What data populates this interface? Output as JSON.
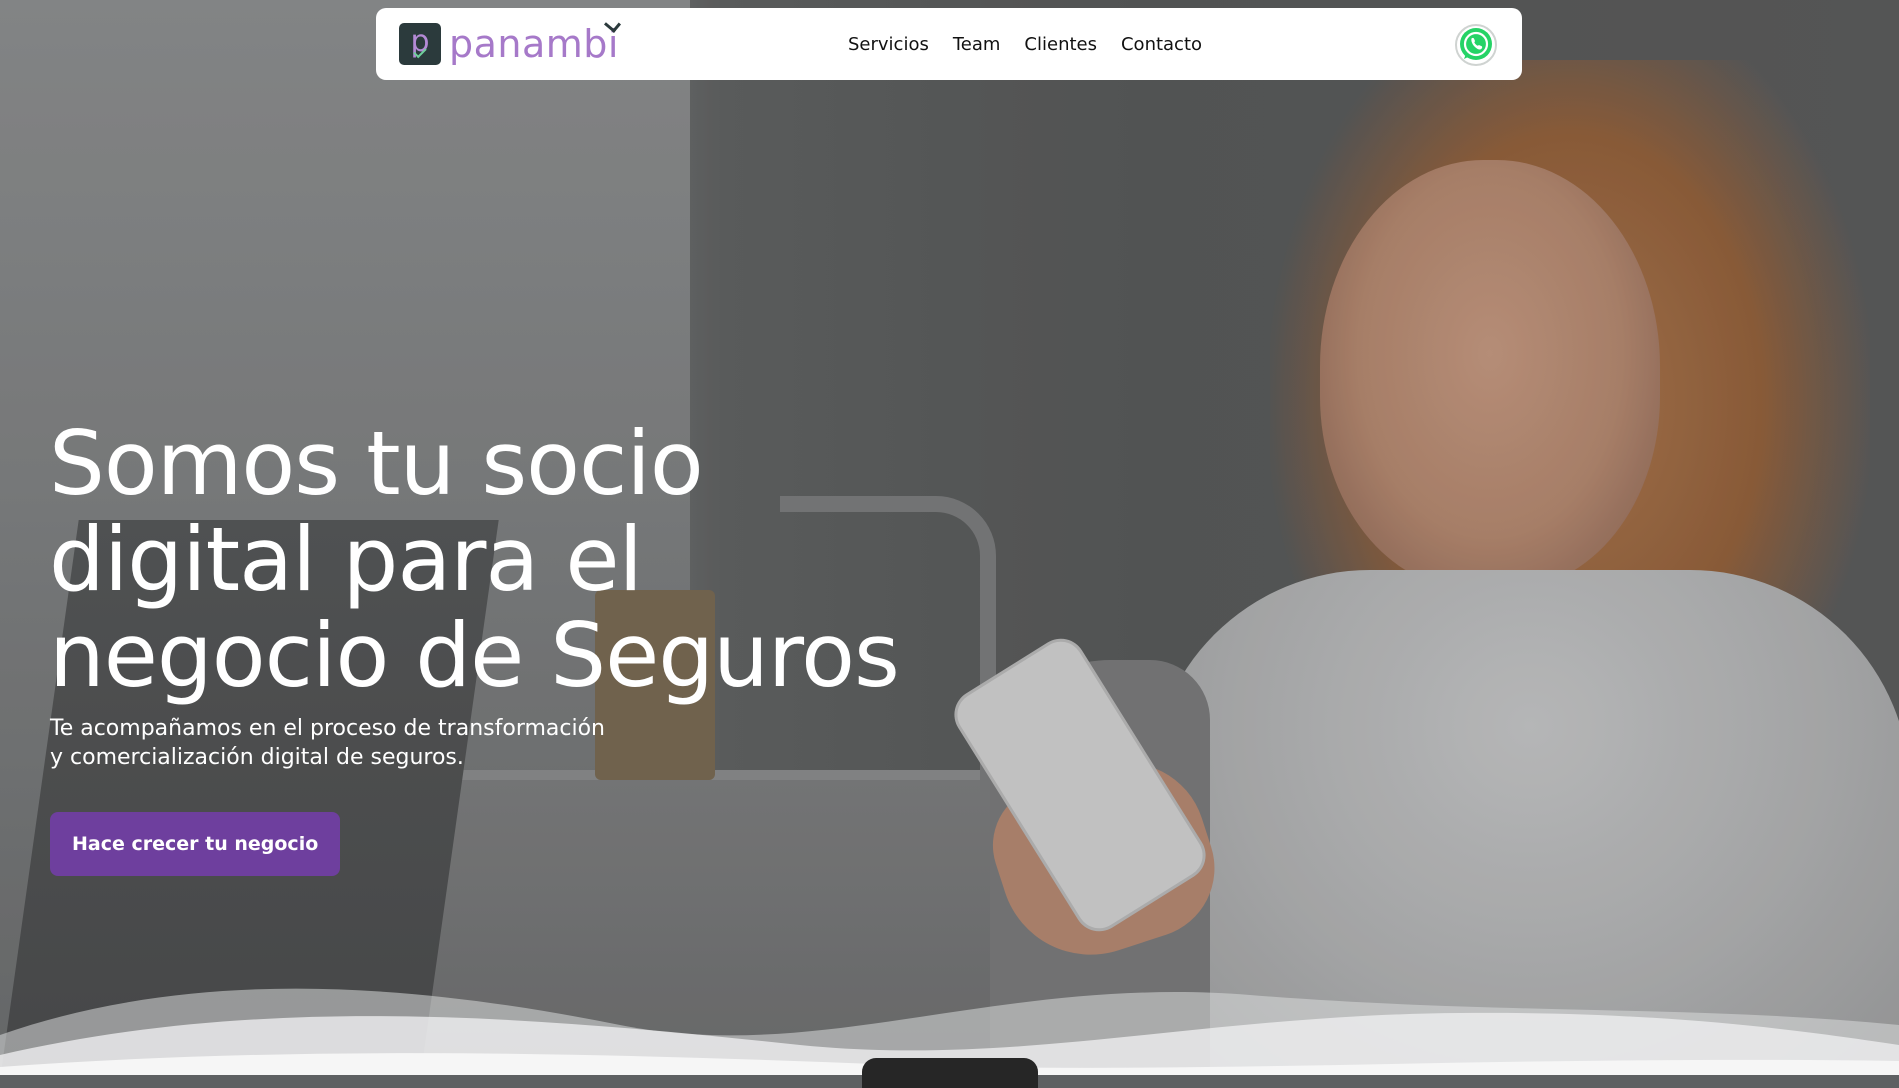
{
  "brand": {
    "name": "panambi",
    "mark_letter": "p",
    "primary_color": "#6e3f9e",
    "logo_text_color": "#a679c9",
    "mark_bg_color": "#2b3a3c"
  },
  "nav": {
    "items": [
      {
        "label": "Servicios"
      },
      {
        "label": "Team"
      },
      {
        "label": "Clientes"
      },
      {
        "label": "Contacto"
      }
    ],
    "whatsapp_icon": "whatsapp-icon",
    "whatsapp_color": "#25d366"
  },
  "hero": {
    "headline": "Somos tu socio\ndigital para el\nnegocio de Seguros",
    "subtitle": "Te acompañamos en el proceso de transformación\ny comercialización digital de seguros.",
    "cta_label": "Hace crecer tu negocio"
  }
}
